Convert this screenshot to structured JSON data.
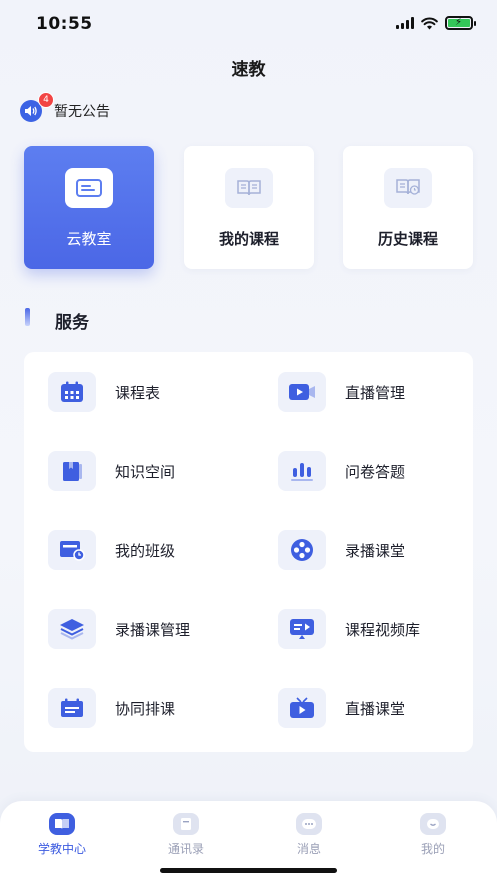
{
  "status_bar": {
    "time": "10:55"
  },
  "nav": {
    "title": "速教"
  },
  "notice": {
    "badge_count": "4",
    "text": "暂无公告"
  },
  "top_cards": [
    {
      "label": "云教室",
      "icon": "cloud-classroom-icon"
    },
    {
      "label": "我的课程",
      "icon": "book-icon"
    },
    {
      "label": "历史课程",
      "icon": "history-book-icon"
    }
  ],
  "services": {
    "title": "服务",
    "items": [
      {
        "label": "课程表",
        "icon": "calendar-icon"
      },
      {
        "label": "直播管理",
        "icon": "video-camera-icon"
      },
      {
        "label": "知识空间",
        "icon": "folder-icon"
      },
      {
        "label": "问卷答题",
        "icon": "bar-chart-icon"
      },
      {
        "label": "我的班级",
        "icon": "class-icon"
      },
      {
        "label": "录播课堂",
        "icon": "film-reel-icon"
      },
      {
        "label": "录播课管理",
        "icon": "layers-icon"
      },
      {
        "label": "课程视频库",
        "icon": "video-library-icon"
      },
      {
        "label": "协同排课",
        "icon": "schedule-icon"
      },
      {
        "label": "直播课堂",
        "icon": "tv-play-icon"
      }
    ]
  },
  "tabbar": {
    "items": [
      {
        "label": "学教中心",
        "active": true
      },
      {
        "label": "通讯录",
        "active": false
      },
      {
        "label": "消息",
        "active": false
      },
      {
        "label": "我的",
        "active": false
      }
    ]
  },
  "colors": {
    "accent": "#4b67e6",
    "badge": "#f24444",
    "icon_bg": "#eef1fa",
    "background": "#f2f4fa"
  }
}
